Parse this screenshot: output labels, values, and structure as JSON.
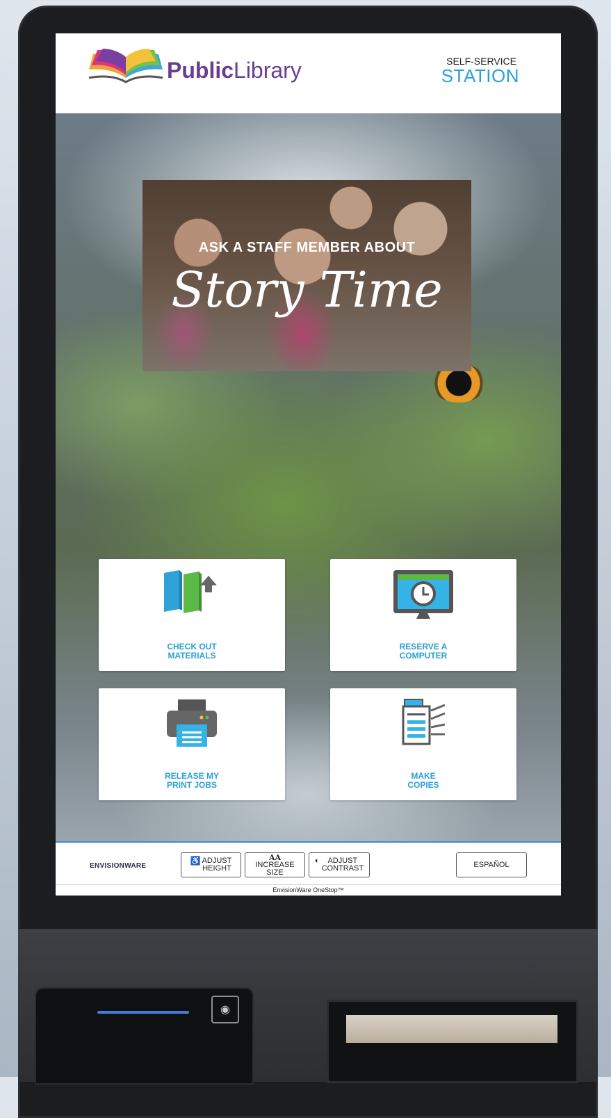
{
  "header": {
    "brand_bold": "Public",
    "brand_light": "Library",
    "station_sub": "SELF-SERVICE",
    "station_main": "STATION"
  },
  "banner": {
    "line1": "ASK A STAFF MEMBER ABOUT",
    "line2": "Story Time"
  },
  "tiles": [
    {
      "label": "CHECK OUT\nMATERIALS",
      "icon": "books-upload-icon"
    },
    {
      "label": "RESERVE A\nCOMPUTER",
      "icon": "computer-clock-icon"
    },
    {
      "label": "RELEASE MY\nPRINT JOBS",
      "icon": "printer-icon"
    },
    {
      "label": "MAKE\nCOPIES",
      "icon": "copier-icon"
    }
  ],
  "footer": {
    "brand": "ENVISIONWARE",
    "adjust_height": "ADJUST\nHEIGHT",
    "increase_size_glyph": "AA",
    "increase_size": "INCREASE\nSIZE",
    "adjust_contrast": "ADJUST\nCONTRAST",
    "language": "ESPAÑOL",
    "product": "EnvisionWare OneStop™"
  },
  "colors": {
    "accent_blue": "#2a9fd6",
    "brand_purple": "#6a3d93",
    "book_blue": "#2fa3d8",
    "book_green": "#5cb947"
  }
}
